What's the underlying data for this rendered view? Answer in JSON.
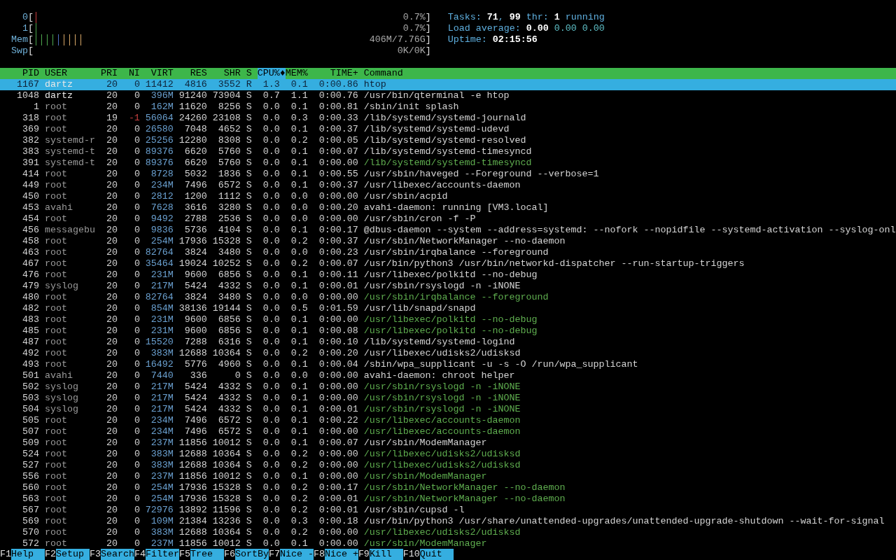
{
  "meters": [
    {
      "label": "0",
      "open": "[",
      "close": "]",
      "reading": "0.7%",
      "segments": [
        {
          "color": "#c83c3c",
          "level": 0.014
        }
      ]
    },
    {
      "label": "1",
      "open": "[",
      "close": "]",
      "reading": "0.7%",
      "segments": [
        {
          "color": "#4ea84e",
          "level": 0.014
        }
      ]
    },
    {
      "label": "Mem",
      "open": "[",
      "close": "]",
      "reading": "406M/7.76G",
      "segments": [
        {
          "color": "#4ea84e",
          "level": 0.057
        },
        {
          "color": "#4d6fc0",
          "level": 0.014
        },
        {
          "color": "#d8a868",
          "level": 0.057
        }
      ]
    },
    {
      "label": "Swp",
      "open": "[",
      "close": "]",
      "reading": "0K/0K"
    }
  ],
  "summary": [
    {
      "parts": [
        {
          "text": "Tasks:",
          "kind": "label"
        },
        {
          "text": "71",
          "kind": "value"
        },
        {
          "text": ",",
          "kind": "separator"
        },
        {
          "text": "99",
          "kind": "value"
        },
        {
          "text": "thr:",
          "kind": "label"
        },
        {
          "text": "1",
          "kind": "value"
        },
        {
          "text": "running",
          "kind": "label"
        }
      ]
    },
    {
      "parts": [
        {
          "text": "Load average:",
          "kind": "label"
        },
        {
          "text": "0.00",
          "kind": "value"
        },
        {
          "text": "0.00",
          "kind": "secondary"
        },
        {
          "text": "0.00",
          "kind": "secondary"
        }
      ]
    },
    {
      "parts": [
        {
          "text": "Uptime:",
          "kind": "label"
        },
        {
          "text": "02:15:56",
          "kind": "value"
        }
      ]
    }
  ],
  "table": {
    "sort_indicator": "♦",
    "columns": [
      {
        "label": "PID",
        "selected": false
      },
      {
        "label": "USER",
        "selected": false
      },
      {
        "label": "PRI",
        "selected": false
      },
      {
        "label": "NI",
        "selected": false
      },
      {
        "label": "VIRT",
        "selected": false
      },
      {
        "label": "RES",
        "selected": false
      },
      {
        "label": "SHR",
        "selected": false
      },
      {
        "label": "S",
        "selected": false
      },
      {
        "label": "CPU%",
        "selected": true
      },
      {
        "label": "MEM%",
        "selected": false
      },
      {
        "label": "TIME+",
        "selected": false
      },
      {
        "label": "Command",
        "selected": false
      }
    ],
    "rows": [
      {
        "pid": "1167",
        "user": "dartz",
        "pri": "20",
        "ni": "0",
        "virt": "11412",
        "res": "4816",
        "shr": "3552",
        "s": "R",
        "cpu": "1.3",
        "mem": "0.1",
        "time": "0:00.86",
        "command": "htop",
        "selected": true,
        "own": true,
        "thread": false,
        "niced": false
      },
      {
        "pid": "1048",
        "user": "dartz",
        "pri": "20",
        "ni": "0",
        "virt": "396M",
        "res": "91240",
        "shr": "73904",
        "s": "S",
        "cpu": "0.7",
        "mem": "1.1",
        "time": "0:00.76",
        "command": "/usr/bin/qterminal -e htop",
        "selected": false,
        "own": true,
        "thread": false,
        "niced": false
      },
      {
        "pid": "1",
        "user": "root",
        "pri": "20",
        "ni": "0",
        "virt": "162M",
        "res": "11620",
        "shr": "8256",
        "s": "S",
        "cpu": "0.0",
        "mem": "0.1",
        "time": "0:00.81",
        "command": "/sbin/init splash",
        "selected": false,
        "own": false,
        "thread": false,
        "niced": false
      },
      {
        "pid": "318",
        "user": "root",
        "pri": "19",
        "ni": "-1",
        "virt": "56064",
        "res": "24260",
        "shr": "23108",
        "s": "S",
        "cpu": "0.0",
        "mem": "0.3",
        "time": "0:00.33",
        "command": "/lib/systemd/systemd-journald",
        "selected": false,
        "own": false,
        "thread": false,
        "niced": true
      },
      {
        "pid": "369",
        "user": "root",
        "pri": "20",
        "ni": "0",
        "virt": "26580",
        "res": "7048",
        "shr": "4652",
        "s": "S",
        "cpu": "0.0",
        "mem": "0.1",
        "time": "0:00.37",
        "command": "/lib/systemd/systemd-udevd",
        "selected": false,
        "own": false,
        "thread": false,
        "niced": false
      },
      {
        "pid": "382",
        "user": "systemd-r",
        "pri": "20",
        "ni": "0",
        "virt": "25256",
        "res": "12280",
        "shr": "8308",
        "s": "S",
        "cpu": "0.0",
        "mem": "0.2",
        "time": "0:00.05",
        "command": "/lib/systemd/systemd-resolved",
        "selected": false,
        "own": false,
        "thread": false,
        "niced": false
      },
      {
        "pid": "383",
        "user": "systemd-t",
        "pri": "20",
        "ni": "0",
        "virt": "89376",
        "res": "6620",
        "shr": "5760",
        "s": "S",
        "cpu": "0.0",
        "mem": "0.1",
        "time": "0:00.07",
        "command": "/lib/systemd/systemd-timesyncd",
        "selected": false,
        "own": false,
        "thread": false,
        "niced": false
      },
      {
        "pid": "391",
        "user": "systemd-t",
        "pri": "20",
        "ni": "0",
        "virt": "89376",
        "res": "6620",
        "shr": "5760",
        "s": "S",
        "cpu": "0.0",
        "mem": "0.1",
        "time": "0:00.00",
        "command": "/lib/systemd/systemd-timesyncd",
        "selected": false,
        "own": false,
        "thread": true,
        "niced": false
      },
      {
        "pid": "414",
        "user": "root",
        "pri": "20",
        "ni": "0",
        "virt": "8728",
        "res": "5032",
        "shr": "1836",
        "s": "S",
        "cpu": "0.0",
        "mem": "0.1",
        "time": "0:00.55",
        "command": "/usr/sbin/haveged --Foreground --verbose=1",
        "selected": false,
        "own": false,
        "thread": false,
        "niced": false
      },
      {
        "pid": "449",
        "user": "root",
        "pri": "20",
        "ni": "0",
        "virt": "234M",
        "res": "7496",
        "shr": "6572",
        "s": "S",
        "cpu": "0.0",
        "mem": "0.1",
        "time": "0:00.37",
        "command": "/usr/libexec/accounts-daemon",
        "selected": false,
        "own": false,
        "thread": false,
        "niced": false
      },
      {
        "pid": "450",
        "user": "root",
        "pri": "20",
        "ni": "0",
        "virt": "2812",
        "res": "1200",
        "shr": "1112",
        "s": "S",
        "cpu": "0.0",
        "mem": "0.0",
        "time": "0:00.00",
        "command": "/usr/sbin/acpid",
        "selected": false,
        "own": false,
        "thread": false,
        "niced": false
      },
      {
        "pid": "453",
        "user": "avahi",
        "pri": "20",
        "ni": "0",
        "virt": "7628",
        "res": "3616",
        "shr": "3280",
        "s": "S",
        "cpu": "0.0",
        "mem": "0.0",
        "time": "0:00.20",
        "command": "avahi-daemon: running [VM3.local]",
        "selected": false,
        "own": false,
        "thread": false,
        "niced": false
      },
      {
        "pid": "454",
        "user": "root",
        "pri": "20",
        "ni": "0",
        "virt": "9492",
        "res": "2788",
        "shr": "2536",
        "s": "S",
        "cpu": "0.0",
        "mem": "0.0",
        "time": "0:00.00",
        "command": "/usr/sbin/cron -f -P",
        "selected": false,
        "own": false,
        "thread": false,
        "niced": false
      },
      {
        "pid": "456",
        "user": "messagebu",
        "pri": "20",
        "ni": "0",
        "virt": "9836",
        "res": "5736",
        "shr": "4104",
        "s": "S",
        "cpu": "0.0",
        "mem": "0.1",
        "time": "0:00.17",
        "command": "@dbus-daemon --system --address=systemd: --nofork --nopidfile --systemd-activation --syslog-onl",
        "selected": false,
        "own": false,
        "thread": false,
        "niced": false
      },
      {
        "pid": "458",
        "user": "root",
        "pri": "20",
        "ni": "0",
        "virt": "254M",
        "res": "17936",
        "shr": "15328",
        "s": "S",
        "cpu": "0.0",
        "mem": "0.2",
        "time": "0:00.37",
        "command": "/usr/sbin/NetworkManager --no-daemon",
        "selected": false,
        "own": false,
        "thread": false,
        "niced": false
      },
      {
        "pid": "463",
        "user": "root",
        "pri": "20",
        "ni": "0",
        "virt": "82764",
        "res": "3824",
        "shr": "3480",
        "s": "S",
        "cpu": "0.0",
        "mem": "0.0",
        "time": "0:00.23",
        "command": "/usr/sbin/irqbalance --foreground",
        "selected": false,
        "own": false,
        "thread": false,
        "niced": false
      },
      {
        "pid": "467",
        "user": "root",
        "pri": "20",
        "ni": "0",
        "virt": "35464",
        "res": "19024",
        "shr": "10252",
        "s": "S",
        "cpu": "0.0",
        "mem": "0.2",
        "time": "0:00.07",
        "command": "/usr/bin/python3 /usr/bin/networkd-dispatcher --run-startup-triggers",
        "selected": false,
        "own": false,
        "thread": false,
        "niced": false
      },
      {
        "pid": "476",
        "user": "root",
        "pri": "20",
        "ni": "0",
        "virt": "231M",
        "res": "9600",
        "shr": "6856",
        "s": "S",
        "cpu": "0.0",
        "mem": "0.1",
        "time": "0:00.11",
        "command": "/usr/libexec/polkitd --no-debug",
        "selected": false,
        "own": false,
        "thread": false,
        "niced": false
      },
      {
        "pid": "479",
        "user": "syslog",
        "pri": "20",
        "ni": "0",
        "virt": "217M",
        "res": "5424",
        "shr": "4332",
        "s": "S",
        "cpu": "0.0",
        "mem": "0.1",
        "time": "0:00.01",
        "command": "/usr/sbin/rsyslogd -n -iNONE",
        "selected": false,
        "own": false,
        "thread": false,
        "niced": false
      },
      {
        "pid": "480",
        "user": "root",
        "pri": "20",
        "ni": "0",
        "virt": "82764",
        "res": "3824",
        "shr": "3480",
        "s": "S",
        "cpu": "0.0",
        "mem": "0.0",
        "time": "0:00.00",
        "command": "/usr/sbin/irqbalance --foreground",
        "selected": false,
        "own": false,
        "thread": true,
        "niced": false
      },
      {
        "pid": "482",
        "user": "root",
        "pri": "20",
        "ni": "0",
        "virt": "854M",
        "res": "38136",
        "shr": "19144",
        "s": "S",
        "cpu": "0.0",
        "mem": "0.5",
        "time": "0:01.59",
        "command": "/usr/lib/snapd/snapd",
        "selected": false,
        "own": false,
        "thread": false,
        "niced": false
      },
      {
        "pid": "483",
        "user": "root",
        "pri": "20",
        "ni": "0",
        "virt": "231M",
        "res": "9600",
        "shr": "6856",
        "s": "S",
        "cpu": "0.0",
        "mem": "0.1",
        "time": "0:00.00",
        "command": "/usr/libexec/polkitd --no-debug",
        "selected": false,
        "own": false,
        "thread": true,
        "niced": false
      },
      {
        "pid": "485",
        "user": "root",
        "pri": "20",
        "ni": "0",
        "virt": "231M",
        "res": "9600",
        "shr": "6856",
        "s": "S",
        "cpu": "0.0",
        "mem": "0.1",
        "time": "0:00.08",
        "command": "/usr/libexec/polkitd --no-debug",
        "selected": false,
        "own": false,
        "thread": true,
        "niced": false
      },
      {
        "pid": "487",
        "user": "root",
        "pri": "20",
        "ni": "0",
        "virt": "15520",
        "res": "7288",
        "shr": "6316",
        "s": "S",
        "cpu": "0.0",
        "mem": "0.1",
        "time": "0:00.10",
        "command": "/lib/systemd/systemd-logind",
        "selected": false,
        "own": false,
        "thread": false,
        "niced": false
      },
      {
        "pid": "492",
        "user": "root",
        "pri": "20",
        "ni": "0",
        "virt": "383M",
        "res": "12688",
        "shr": "10364",
        "s": "S",
        "cpu": "0.0",
        "mem": "0.2",
        "time": "0:00.20",
        "command": "/usr/libexec/udisks2/udisksd",
        "selected": false,
        "own": false,
        "thread": false,
        "niced": false
      },
      {
        "pid": "493",
        "user": "root",
        "pri": "20",
        "ni": "0",
        "virt": "16492",
        "res": "5776",
        "shr": "4960",
        "s": "S",
        "cpu": "0.0",
        "mem": "0.1",
        "time": "0:00.04",
        "command": "/sbin/wpa_supplicant -u -s -O /run/wpa_supplicant",
        "selected": false,
        "own": false,
        "thread": false,
        "niced": false
      },
      {
        "pid": "501",
        "user": "avahi",
        "pri": "20",
        "ni": "0",
        "virt": "7440",
        "res": "336",
        "shr": "0",
        "s": "S",
        "cpu": "0.0",
        "mem": "0.0",
        "time": "0:00.00",
        "command": "avahi-daemon: chroot helper",
        "selected": false,
        "own": false,
        "thread": false,
        "niced": false
      },
      {
        "pid": "502",
        "user": "syslog",
        "pri": "20",
        "ni": "0",
        "virt": "217M",
        "res": "5424",
        "shr": "4332",
        "s": "S",
        "cpu": "0.0",
        "mem": "0.1",
        "time": "0:00.00",
        "command": "/usr/sbin/rsyslogd -n -iNONE",
        "selected": false,
        "own": false,
        "thread": true,
        "niced": false
      },
      {
        "pid": "503",
        "user": "syslog",
        "pri": "20",
        "ni": "0",
        "virt": "217M",
        "res": "5424",
        "shr": "4332",
        "s": "S",
        "cpu": "0.0",
        "mem": "0.1",
        "time": "0:00.00",
        "command": "/usr/sbin/rsyslogd -n -iNONE",
        "selected": false,
        "own": false,
        "thread": true,
        "niced": false
      },
      {
        "pid": "504",
        "user": "syslog",
        "pri": "20",
        "ni": "0",
        "virt": "217M",
        "res": "5424",
        "shr": "4332",
        "s": "S",
        "cpu": "0.0",
        "mem": "0.1",
        "time": "0:00.01",
        "command": "/usr/sbin/rsyslogd -n -iNONE",
        "selected": false,
        "own": false,
        "thread": true,
        "niced": false
      },
      {
        "pid": "505",
        "user": "root",
        "pri": "20",
        "ni": "0",
        "virt": "234M",
        "res": "7496",
        "shr": "6572",
        "s": "S",
        "cpu": "0.0",
        "mem": "0.1",
        "time": "0:00.22",
        "command": "/usr/libexec/accounts-daemon",
        "selected": false,
        "own": false,
        "thread": true,
        "niced": false
      },
      {
        "pid": "507",
        "user": "root",
        "pri": "20",
        "ni": "0",
        "virt": "234M",
        "res": "7496",
        "shr": "6572",
        "s": "S",
        "cpu": "0.0",
        "mem": "0.1",
        "time": "0:00.00",
        "command": "/usr/libexec/accounts-daemon",
        "selected": false,
        "own": false,
        "thread": true,
        "niced": false
      },
      {
        "pid": "509",
        "user": "root",
        "pri": "20",
        "ni": "0",
        "virt": "237M",
        "res": "11856",
        "shr": "10012",
        "s": "S",
        "cpu": "0.0",
        "mem": "0.1",
        "time": "0:00.07",
        "command": "/usr/sbin/ModemManager",
        "selected": false,
        "own": false,
        "thread": false,
        "niced": false
      },
      {
        "pid": "524",
        "user": "root",
        "pri": "20",
        "ni": "0",
        "virt": "383M",
        "res": "12688",
        "shr": "10364",
        "s": "S",
        "cpu": "0.0",
        "mem": "0.2",
        "time": "0:00.00",
        "command": "/usr/libexec/udisks2/udisksd",
        "selected": false,
        "own": false,
        "thread": true,
        "niced": false
      },
      {
        "pid": "527",
        "user": "root",
        "pri": "20",
        "ni": "0",
        "virt": "383M",
        "res": "12688",
        "shr": "10364",
        "s": "S",
        "cpu": "0.0",
        "mem": "0.2",
        "time": "0:00.00",
        "command": "/usr/libexec/udisks2/udisksd",
        "selected": false,
        "own": false,
        "thread": true,
        "niced": false
      },
      {
        "pid": "556",
        "user": "root",
        "pri": "20",
        "ni": "0",
        "virt": "237M",
        "res": "11856",
        "shr": "10012",
        "s": "S",
        "cpu": "0.0",
        "mem": "0.1",
        "time": "0:00.00",
        "command": "/usr/sbin/ModemManager",
        "selected": false,
        "own": false,
        "thread": true,
        "niced": false
      },
      {
        "pid": "560",
        "user": "root",
        "pri": "20",
        "ni": "0",
        "virt": "254M",
        "res": "17936",
        "shr": "15328",
        "s": "S",
        "cpu": "0.0",
        "mem": "0.2",
        "time": "0:00.17",
        "command": "/usr/sbin/NetworkManager --no-daemon",
        "selected": false,
        "own": false,
        "thread": true,
        "niced": false
      },
      {
        "pid": "563",
        "user": "root",
        "pri": "20",
        "ni": "0",
        "virt": "254M",
        "res": "17936",
        "shr": "15328",
        "s": "S",
        "cpu": "0.0",
        "mem": "0.2",
        "time": "0:00.01",
        "command": "/usr/sbin/NetworkManager --no-daemon",
        "selected": false,
        "own": false,
        "thread": true,
        "niced": false
      },
      {
        "pid": "567",
        "user": "root",
        "pri": "20",
        "ni": "0",
        "virt": "72976",
        "res": "13892",
        "shr": "11596",
        "s": "S",
        "cpu": "0.0",
        "mem": "0.2",
        "time": "0:00.01",
        "command": "/usr/sbin/cupsd -l",
        "selected": false,
        "own": false,
        "thread": false,
        "niced": false
      },
      {
        "pid": "569",
        "user": "root",
        "pri": "20",
        "ni": "0",
        "virt": "109M",
        "res": "21384",
        "shr": "13236",
        "s": "S",
        "cpu": "0.0",
        "mem": "0.3",
        "time": "0:00.18",
        "command": "/usr/bin/python3 /usr/share/unattended-upgrades/unattended-upgrade-shutdown --wait-for-signal",
        "selected": false,
        "own": false,
        "thread": false,
        "niced": false
      },
      {
        "pid": "570",
        "user": "root",
        "pri": "20",
        "ni": "0",
        "virt": "383M",
        "res": "12688",
        "shr": "10364",
        "s": "S",
        "cpu": "0.0",
        "mem": "0.2",
        "time": "0:00.00",
        "command": "/usr/libexec/udisks2/udisksd",
        "selected": false,
        "own": false,
        "thread": true,
        "niced": false
      },
      {
        "pid": "572",
        "user": "root",
        "pri": "20",
        "ni": "0",
        "virt": "237M",
        "res": "11856",
        "shr": "10012",
        "s": "S",
        "cpu": "0.0",
        "mem": "0.1",
        "time": "0:00.00",
        "command": "/usr/sbin/ModemManager",
        "selected": false,
        "own": false,
        "thread": true,
        "niced": false
      }
    ]
  },
  "function_bar": [
    {
      "key": "F1",
      "label": "Help"
    },
    {
      "key": "F2",
      "label": "Setup"
    },
    {
      "key": "F3",
      "label": "Search"
    },
    {
      "key": "F4",
      "label": "Filter"
    },
    {
      "key": "F5",
      "label": "Tree"
    },
    {
      "key": "F6",
      "label": "SortBy"
    },
    {
      "key": "F7",
      "label": "Nice -"
    },
    {
      "key": "F8",
      "label": "Nice +"
    },
    {
      "key": "F9",
      "label": "Kill"
    },
    {
      "key": "F10",
      "label": "Quit"
    }
  ]
}
